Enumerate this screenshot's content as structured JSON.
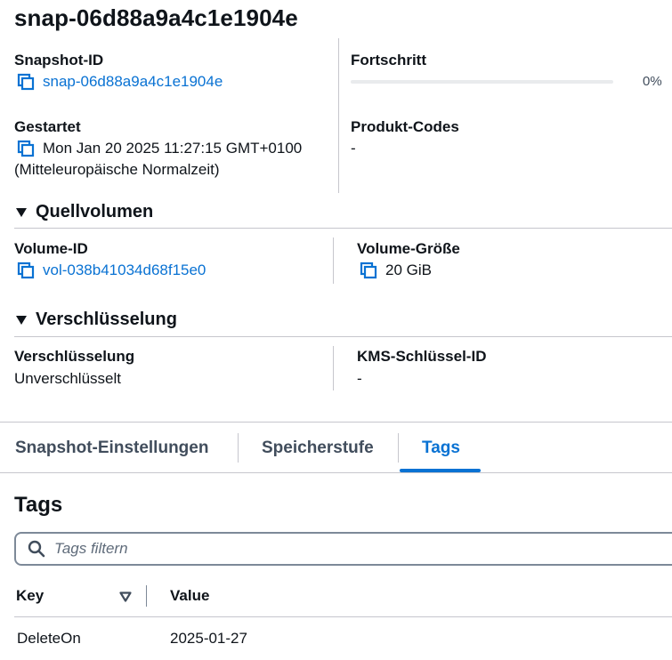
{
  "title": "snap-06d88a9a4c1e1904e",
  "details": {
    "snapshot_id_label": "Snapshot-ID",
    "snapshot_id_value": "snap-06d88a9a4c1e1904e",
    "progress_label": "Fortschritt",
    "progress_value": 0,
    "progress_text": "0%",
    "started_label": "Gestartet",
    "started_value": "Mon Jan 20 2025 11:27:15 GMT+0100",
    "started_tz": "(Mitteleuropäische Normalzeit)",
    "product_codes_label": "Produkt-Codes",
    "product_codes_value": "-"
  },
  "source_volume": {
    "heading": "Quellvolumen",
    "volume_id_label": "Volume-ID",
    "volume_id_value": "vol-038b41034d68f15e0",
    "volume_size_label": "Volume-Größe",
    "volume_size_value": "20 GiB"
  },
  "encryption": {
    "heading": "Verschlüsselung",
    "encryption_label": "Verschlüsselung",
    "encryption_value": "Unverschlüsselt",
    "kms_label": "KMS-Schlüssel-ID",
    "kms_value": "-"
  },
  "tabs": [
    {
      "label": "Snapshot-Einstellungen",
      "active": false
    },
    {
      "label": "Speicherstufe",
      "active": false
    },
    {
      "label": "Tags",
      "active": true
    }
  ],
  "tags": {
    "heading": "Tags",
    "filter_placeholder": "Tags filtern",
    "filter_value": "",
    "columns": [
      "Key",
      "Value"
    ],
    "rows": [
      {
        "key": "DeleteOn",
        "value": "2025-01-27"
      }
    ]
  },
  "colors": {
    "link": "#0972d3",
    "text": "#0f141a",
    "divider": "#c6c6cd"
  }
}
